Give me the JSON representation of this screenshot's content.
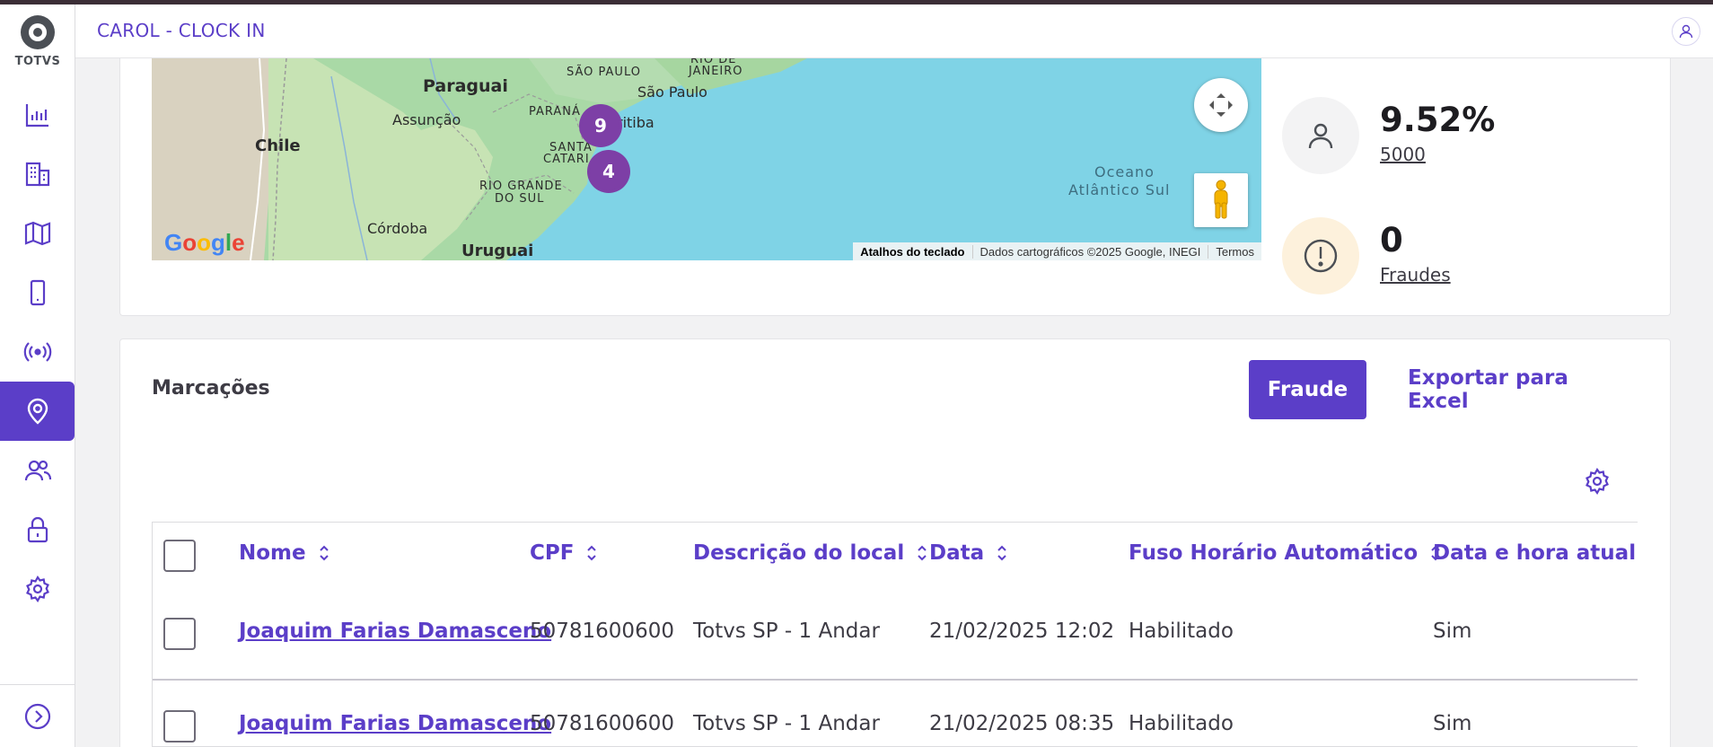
{
  "header": {
    "app_title": "CAROL - CLOCK IN"
  },
  "sidebar": {
    "logo_text": "TOTVS",
    "items": [
      {
        "icon": "chart-bar-icon",
        "active": false
      },
      {
        "icon": "building-icon",
        "active": false
      },
      {
        "icon": "map-icon",
        "active": false
      },
      {
        "icon": "mobile-device-icon",
        "active": false
      },
      {
        "icon": "broadcast-icon",
        "active": false
      },
      {
        "icon": "map-pin-icon",
        "active": true
      },
      {
        "icon": "users-icon",
        "active": false
      },
      {
        "icon": "lock-icon",
        "active": false
      },
      {
        "icon": "gear-icon",
        "active": false
      }
    ],
    "expand_icon": "chevron-right-circle-icon"
  },
  "map": {
    "labels": {
      "paraguai": "Paraguai",
      "sao_paulo_state": "SÃO PAULO",
      "rio_de_janeiro_1": "RIO DE",
      "rio_de_janeiro_2": "JANEIRO",
      "sao_paulo_city": "São Paulo",
      "assuncao": "Assunção",
      "parana": "PARANÁ",
      "curitiba": "ritiba",
      "chile": "Chile",
      "santa": "SANTA",
      "catarina": "CATARI",
      "oceano1": "Oceano",
      "oceano2": "Atlântico Sul",
      "rio_grande1": "RIO GRANDE",
      "rio_grande2": "DO SUL",
      "cordoba": "Córdoba",
      "uruguai": "Uruguai"
    },
    "clusters": [
      "9",
      "4"
    ],
    "google_logo": "Google",
    "attribution": {
      "shortcuts": "Atalhos do teclado",
      "data": "Dados cartográficos ©2025 Google, INEGI",
      "terms": "Termos"
    }
  },
  "stats": [
    {
      "value": "9.52%",
      "label": "5000",
      "icon": "person-icon"
    },
    {
      "value": "0",
      "label": "Fraudes",
      "icon": "alert-circle-icon"
    }
  ],
  "markings": {
    "title": "Marcações",
    "fraud_button": "Fraude",
    "export_button": "Exportar para Excel",
    "settings_icon": "gear-icon",
    "columns": [
      "Nome",
      "CPF",
      "Descrição do local",
      "Data",
      "Fuso Horário Automático",
      "Data e hora atualiza"
    ],
    "rows": [
      {
        "nome": "Joaquim Farias Damasceno",
        "cpf": "50781600600",
        "local": "Totvs SP - 1 Andar",
        "data": "21/02/2025 12:02",
        "fuso": "Habilitado",
        "atualizada": "Sim"
      },
      {
        "nome": "Joaquim Farias Damasceno",
        "cpf": "50781600600",
        "local": "Totvs SP - 1 Andar",
        "data": "21/02/2025 08:35",
        "fuso": "Habilitado",
        "atualizada": "Sim"
      }
    ]
  },
  "colors": {
    "accent": "#5b3ec8",
    "cluster": "#7d3fa6",
    "map_water": "#7fd3e6"
  }
}
